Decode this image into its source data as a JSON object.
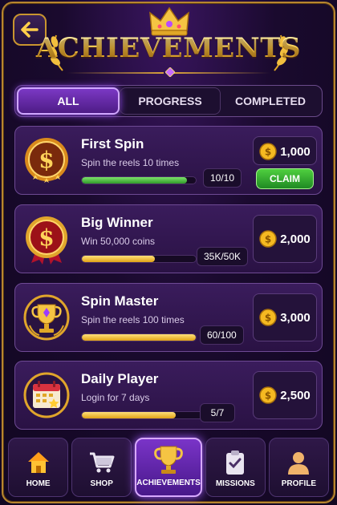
{
  "header": {
    "title": "ACHIEVEMENTS"
  },
  "tabs": [
    {
      "label": "ALL",
      "active": true
    },
    {
      "label": "PROGRESS",
      "active": false
    },
    {
      "label": "COMPLETED",
      "active": false
    }
  ],
  "achievements": [
    {
      "title": "First Spin",
      "description": "Spin the reels 10 times",
      "progress_text": "10/10",
      "progress": 1.0,
      "reward": "1,000",
      "claim_label": "CLAIM",
      "medal_icon": "dollar-medal-icon"
    },
    {
      "title": "Big Winner",
      "description": "Win 50,000 coins",
      "progress_text": "35K/50K",
      "progress": 0.7,
      "reward": "2,000",
      "medal_icon": "dollar-ribbon-medal-icon"
    },
    {
      "title": "Spin Master",
      "description": "Spin the reels 100 times",
      "progress_text": "60/100",
      "progress": 0.6,
      "reward": "3,000",
      "medal_icon": "trophy-medal-icon"
    },
    {
      "title": "Daily Player",
      "description": "Login for 7 days",
      "progress_text": "5/7",
      "progress": 0.71,
      "reward": "2,500",
      "medal_icon": "calendar-medal-icon"
    }
  ],
  "nav": [
    {
      "label": "HOME",
      "icon": "home-icon",
      "active": false
    },
    {
      "label": "SHOP",
      "icon": "cart-icon",
      "active": false
    },
    {
      "label": "ACHIEVEMENTS",
      "icon": "trophy-icon",
      "active": true
    },
    {
      "label": "MISSIONS",
      "icon": "clipboard-icon",
      "active": false
    },
    {
      "label": "PROFILE",
      "icon": "user-icon",
      "active": false
    }
  ],
  "colors": {
    "accent_gold": "#f7c948",
    "accent_purple": "#7b38c4",
    "claim_green": "#2f9a2a"
  }
}
